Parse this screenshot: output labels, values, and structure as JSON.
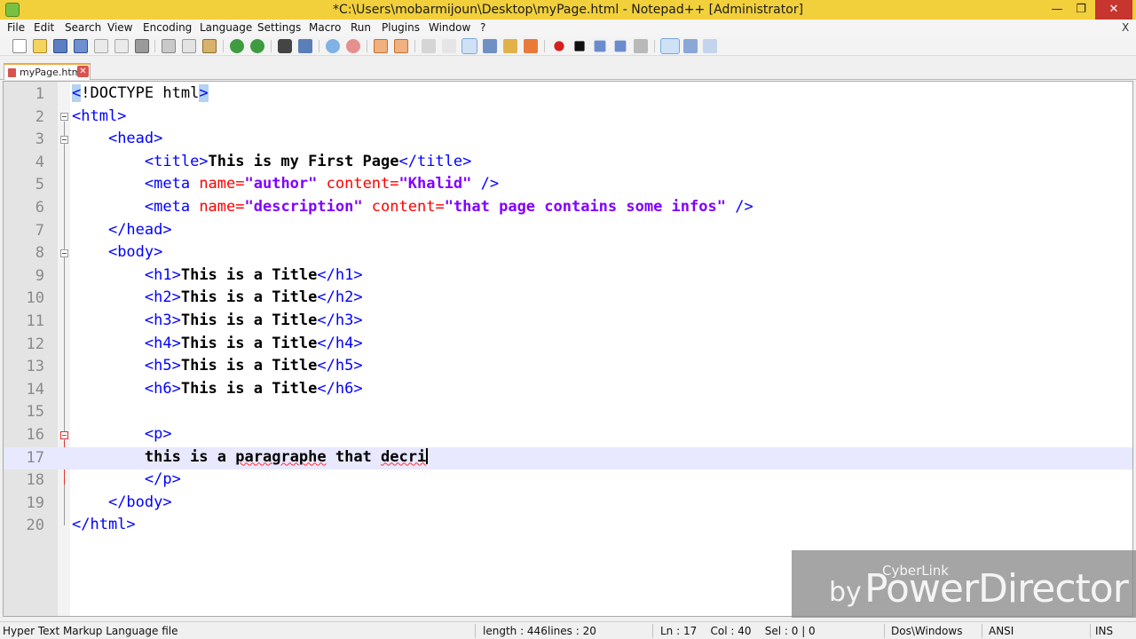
{
  "window": {
    "title": "*C:\\Users\\mobarmijoun\\Desktop\\myPage.html - Notepad++ [Administrator]",
    "controls": {
      "minimize": "—",
      "maximize": "❐",
      "close": "✕"
    }
  },
  "menu": {
    "items": [
      "File",
      "Edit",
      "Search",
      "View",
      "Encoding",
      "Language",
      "Settings",
      "Macro",
      "Run",
      "Plugins",
      "Window",
      "?"
    ],
    "close_doc": "X"
  },
  "toolbar": {
    "icons": [
      "new-file-icon",
      "open-file-icon",
      "save-icon",
      "save-all-icon",
      "close-icon",
      "close-all-icon",
      "print-icon",
      "cut-icon",
      "copy-icon",
      "paste-icon",
      "undo-icon",
      "redo-icon",
      "find-icon",
      "replace-icon",
      "zoom-in-icon",
      "zoom-out-icon",
      "sync-vertical-icon",
      "sync-horizontal-icon",
      "word-wrap-icon",
      "show-all-chars-icon",
      "indent-guide-icon",
      "doc-map-icon",
      "function-list-icon",
      "folder-workspace-icon",
      "record-macro-icon",
      "stop-macro-icon",
      "play-macro-icon",
      "run-macro-multiple-icon",
      "save-macro-icon",
      "spellcheck-icon",
      "spellcheck-options-icon",
      "spellcheck-next-icon"
    ]
  },
  "tab": {
    "label": "myPage.html",
    "close": "✕",
    "color": "#f2a73b"
  },
  "editor": {
    "lines": [
      {
        "n": "1"
      },
      {
        "n": "2"
      },
      {
        "n": "3"
      },
      {
        "n": "4"
      },
      {
        "n": "5"
      },
      {
        "n": "6"
      },
      {
        "n": "7"
      },
      {
        "n": "8"
      },
      {
        "n": "9"
      },
      {
        "n": "10"
      },
      {
        "n": "11"
      },
      {
        "n": "12"
      },
      {
        "n": "13"
      },
      {
        "n": "14"
      },
      {
        "n": "15"
      },
      {
        "n": "16"
      },
      {
        "n": "17"
      },
      {
        "n": "18"
      },
      {
        "n": "19"
      },
      {
        "n": "20"
      }
    ],
    "code": {
      "l1_open": "<",
      "l1_mid": "!DOCTYPE html",
      "l1_close": ">",
      "l2": "<html>",
      "l3": "<head>",
      "l4_open": "<title>",
      "l4_text": "This is my First Page",
      "l4_close": "</title>",
      "l5_open": "<meta ",
      "l5_attr1": "name=",
      "l5_val1": "\"author\"",
      "l5_attr2": " content=",
      "l5_val2": "\"Khalid\"",
      "l5_close": " />",
      "l6_open": "<meta ",
      "l6_attr1": "name=",
      "l6_val1": "\"description\"",
      "l6_attr2": " content=",
      "l6_val2": "\"that page contains some infos\"",
      "l6_close": " />",
      "l7": "</head>",
      "l8": "<body>",
      "l9_open": "<h1>",
      "l9_text": "This is a Title",
      "l9_close": "</h1>",
      "l10_open": "<h2>",
      "l10_text": "This is a Title",
      "l10_close": "</h2>",
      "l11_open": "<h3>",
      "l11_text": "This is a Title",
      "l11_close": "</h3>",
      "l12_open": "<h4>",
      "l12_text": "This is a Title",
      "l12_close": "</h4>",
      "l13_open": "<h5>",
      "l13_text": "This is a Title",
      "l13_close": "</h5>",
      "l14_open": "<h6>",
      "l14_text": "This is a Title",
      "l14_close": "</h6>",
      "l16": "<p>",
      "l17_a": "this is a ",
      "l17_b": "paragraphe",
      "l17_c": " that ",
      "l17_d": "decri",
      "l18": "</p>",
      "l19": "</body>",
      "l20": "</html>"
    }
  },
  "watermark": {
    "cyberlink": "CyberLink",
    "by": "by",
    "product": "PowerDirector"
  },
  "status": {
    "filetype": "Hyper Text Markup Language file",
    "length": "length : 446",
    "lines": "lines : 20",
    "position": "Ln : 17    Col : 40    Sel : 0 | 0",
    "eol": "Dos\\Windows",
    "encoding": "ANSI",
    "mode": "INS"
  }
}
